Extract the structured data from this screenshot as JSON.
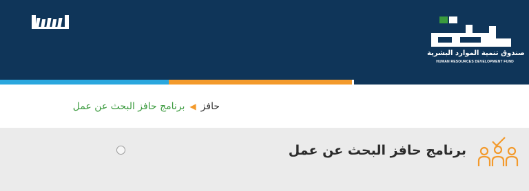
{
  "header": {
    "fund_name_ar": "صندوق تنمية الموارد البشرية",
    "fund_name_en": "HUMAN RESOURCES DEVELOPMENT FUND",
    "logo_icon": "hrdf-logo",
    "vision_icon": "vision-2030-logo"
  },
  "breadcrumb": {
    "home_label": "حافز",
    "separator_icon": "chevron-left-icon",
    "current_label": "برنامج حافز البحث عن عمل"
  },
  "section": {
    "title": "برنامج حافز البحث عن عمل",
    "icon": "people-checkmark-icon"
  },
  "colors": {
    "header_bg": "#0f3559",
    "accent_blue": "#2aa7de",
    "accent_orange": "#f39a2c",
    "accent_green": "#3a9a3d",
    "section_bg": "#ebebeb"
  }
}
